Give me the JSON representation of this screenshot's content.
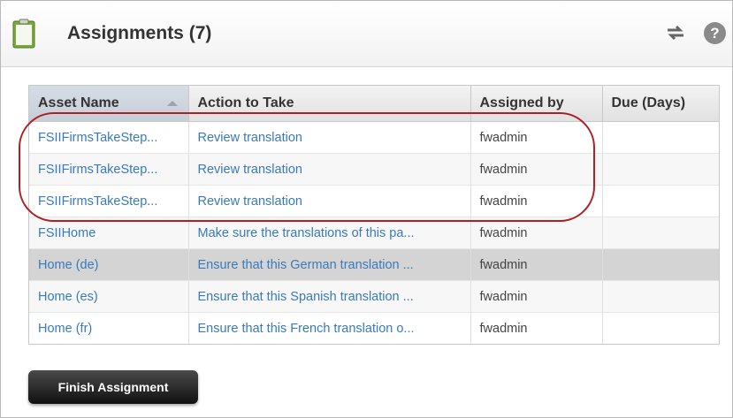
{
  "panel": {
    "title": "Assignments (7)",
    "icons": {
      "panel": "clipboard-icon",
      "refresh": "refresh-arrows-icon",
      "help": "help-icon"
    },
    "help_glyph": "?"
  },
  "table": {
    "columns": [
      "Asset Name",
      "Action to Take",
      "Assigned by",
      "Due (Days)"
    ],
    "sorted_column": "Asset Name",
    "rows": [
      {
        "asset": "FSIIFirmsTakeStep...",
        "action": "Review translation",
        "assigned_by": "fwadmin",
        "due": ""
      },
      {
        "asset": "FSIIFirmsTakeStep...",
        "action": "Review translation",
        "assigned_by": "fwadmin",
        "due": ""
      },
      {
        "asset": "FSIIFirmsTakeStep...",
        "action": "Review translation",
        "assigned_by": "fwadmin",
        "due": ""
      },
      {
        "asset": "FSIIHome",
        "action": "Make sure the translations of this pa...",
        "assigned_by": "fwadmin",
        "due": ""
      },
      {
        "asset": "Home (de)",
        "action": "Ensure that this German translation ...",
        "assigned_by": "fwadmin",
        "due": ""
      },
      {
        "asset": "Home (es)",
        "action": "Ensure that this Spanish translation ...",
        "assigned_by": "fwadmin",
        "due": ""
      },
      {
        "asset": "Home (fr)",
        "action": "Ensure that this French translation o...",
        "assigned_by": "fwadmin",
        "due": ""
      }
    ],
    "selected_row": 4
  },
  "actions": {
    "finish_label": "Finish Assignment"
  },
  "colors": {
    "link": "#3a7ab8",
    "highlight": "#b01f24",
    "selected_row": "#d4d4d4"
  }
}
